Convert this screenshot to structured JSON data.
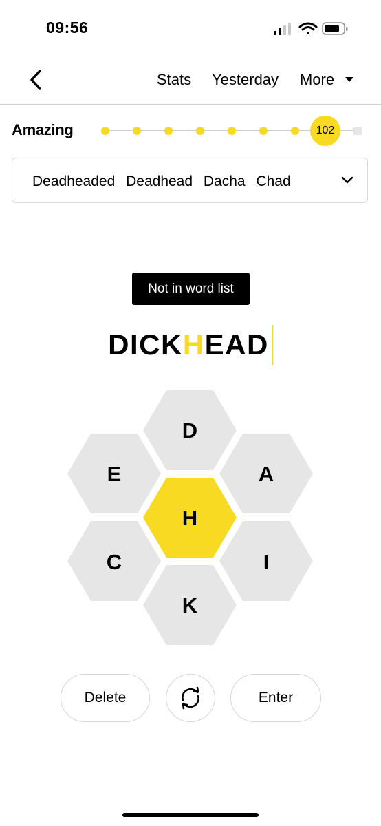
{
  "status_bar": {
    "time": "09:56",
    "icons": [
      "signal-icon",
      "wifi-icon",
      "battery-icon"
    ]
  },
  "nav": {
    "back_icon": "chevron-left-icon",
    "stats": "Stats",
    "yesterday": "Yesterday",
    "more": "More"
  },
  "progress": {
    "rank": "Amazing",
    "score": "102",
    "accent_color": "#f7da21"
  },
  "found_words": {
    "words": [
      "Deadheaded",
      "Deadhead",
      "Dacha",
      "Chad"
    ],
    "expand_icon": "chevron-down-icon"
  },
  "message": "Not in word list",
  "input": {
    "before": "DICK",
    "center": "H",
    "after": "EAD"
  },
  "hive": {
    "center": "H",
    "letters": {
      "top": "D",
      "upper_left": "E",
      "upper_right": "A",
      "lower_left": "C",
      "lower_right": "I",
      "bottom": "K"
    },
    "center_color": "#f7da21",
    "outer_color": "#e6e6e6"
  },
  "controls": {
    "delete": "Delete",
    "shuffle_icon": "shuffle-icon",
    "enter": "Enter"
  }
}
